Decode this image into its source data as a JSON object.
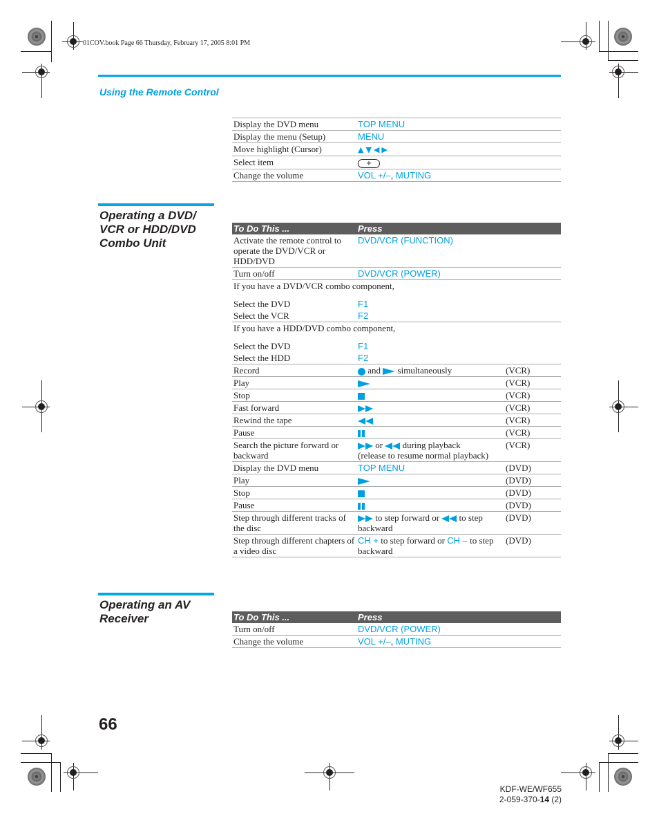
{
  "slug": "01COV.book  Page 66  Thursday, February 17, 2005  8:01 PM",
  "section_header": "Using the Remote Control",
  "table1": {
    "rows": [
      {
        "action": "Display the DVD menu",
        "press": "TOP MENU"
      },
      {
        "action": "Display the menu (Setup)",
        "press": "MENU"
      },
      {
        "action": "Move highlight (Cursor)",
        "press_icon": "arrow-keys-icon",
        "press_glyph": "▲▼◀▶"
      },
      {
        "action": "Select item",
        "press_icon": "enter-button-icon",
        "press_glyph": "-+-"
      },
      {
        "action": "Change the volume",
        "press": "VOL +/–",
        "press_sep": ", ",
        "press2": "MUTING"
      }
    ]
  },
  "section2": {
    "title": "Operating a DVD/ VCR or HDD/DVD Combo Unit",
    "header": {
      "col1": "To Do This ...",
      "col2": "Press"
    },
    "rows": [
      {
        "action": "Activate the remote control to operate the DVD/VCR or HDD/DVD",
        "press": "DVD/VCR (FUNCTION)"
      },
      {
        "action": "Turn on/off",
        "press": "DVD/VCR (POWER)"
      },
      {
        "note": "If you have a DVD/VCR combo component,"
      },
      {
        "action": "Select the DVD",
        "press": "F1"
      },
      {
        "action": "Select the VCR",
        "press": "F2"
      },
      {
        "note": "If you have a HDD/DVD combo component,"
      },
      {
        "action": "Select the DVD",
        "press": "F1"
      },
      {
        "action": "Select the HDD",
        "press": "F2"
      },
      {
        "action": "Record",
        "and_text": "and",
        "rest_text": "simultaneously",
        "mode": "(VCR)"
      },
      {
        "action": "Play",
        "mode": "(VCR)"
      },
      {
        "action": "Stop",
        "mode": "(VCR)"
      },
      {
        "action": "Fast forward",
        "mode": "(VCR)"
      },
      {
        "action": "Rewind the tape",
        "mode": "(VCR)"
      },
      {
        "action": "Pause",
        "mode": "(VCR)"
      },
      {
        "action": "Search the picture forward or backward",
        "or_text": "or",
        "rest_text": "during playback",
        "line2": "(release to resume normal playback)",
        "mode": "(VCR)"
      },
      {
        "action": "Display the DVD menu",
        "press": "TOP MENU",
        "mode": "(DVD)"
      },
      {
        "action": "Play",
        "mode": "(DVD)"
      },
      {
        "action": "Stop",
        "mode": "(DVD)"
      },
      {
        "action": "Pause",
        "mode": "(DVD)"
      },
      {
        "action": "Step through different tracks of the disc",
        "text1": "to step forward or",
        "text2": "to step backward",
        "mode": "(DVD)"
      },
      {
        "action": "Step through different chapters of a video disc",
        "press_a": "CH +",
        "text1": " to step forward or ",
        "press_b": "CH –",
        "text2": " to step backward",
        "mode": "(DVD)"
      }
    ]
  },
  "section3": {
    "title": "Operating an AV Receiver",
    "header": {
      "col1": "To Do This ...",
      "col2": "Press"
    },
    "rows": [
      {
        "action": "Turn on/off",
        "press": "DVD/VCR (POWER)"
      },
      {
        "action": "Change the volume",
        "press": "VOL +/–",
        "press_sep": ", ",
        "press2": "MUTING"
      }
    ]
  },
  "footer": {
    "page_number": "66",
    "model": "KDF-WE/WF655",
    "part_prefix": "2-059-370-",
    "part_bold": "14",
    "part_suffix": " (2)"
  },
  "colors": {
    "accent": "#00a0e0",
    "header_bar": "#5d5d5d",
    "rule": "#a7a9ac"
  }
}
